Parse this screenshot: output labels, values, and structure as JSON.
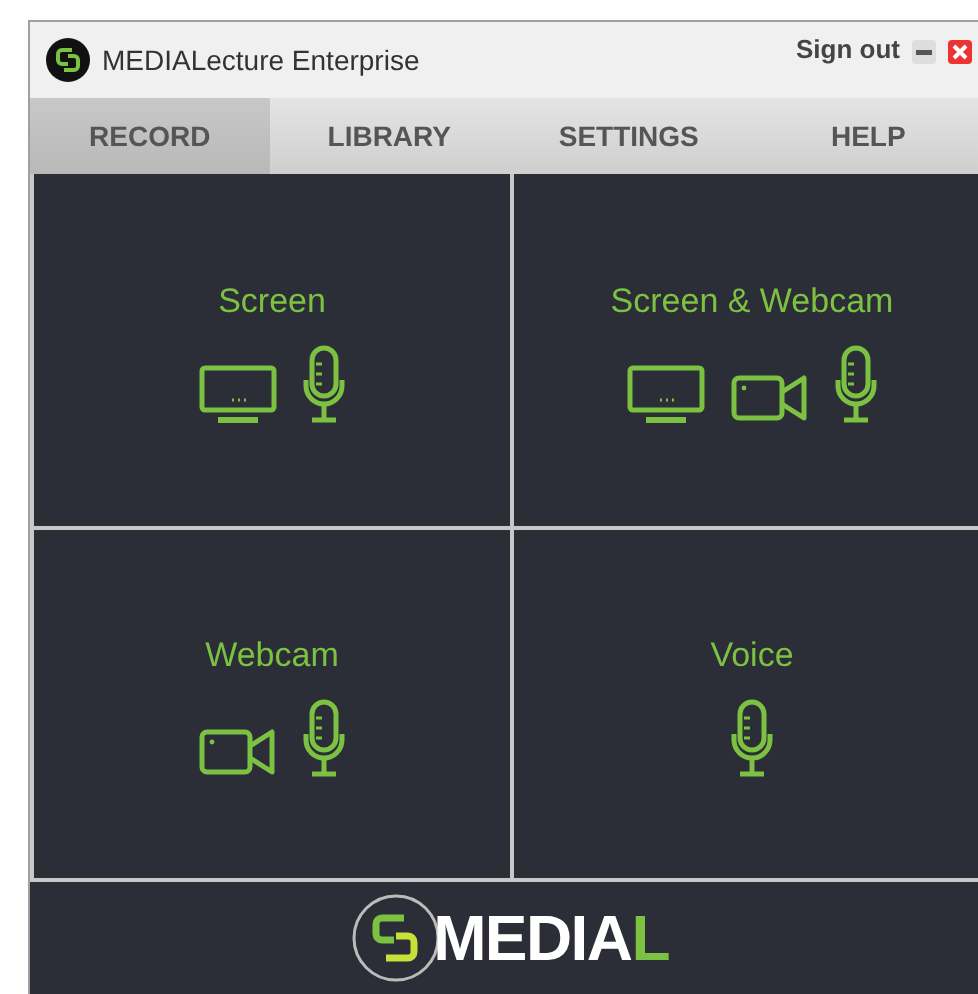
{
  "window": {
    "title": "MEDIALecture Enterprise",
    "sign_out": "Sign out"
  },
  "tabs": [
    {
      "label": "RECORD",
      "selected": true
    },
    {
      "label": "LIBRARY",
      "selected": false
    },
    {
      "label": "SETTINGS",
      "selected": false
    },
    {
      "label": "HELP",
      "selected": false
    }
  ],
  "tiles": [
    {
      "label": "Screen",
      "kind": "screen"
    },
    {
      "label": "Screen & Webcam",
      "kind": "screen_webcam"
    },
    {
      "label": "Webcam",
      "kind": "webcam"
    },
    {
      "label": "Voice",
      "kind": "voice"
    }
  ],
  "footer": {
    "logo_text": "MEDIA",
    "logo_accent": "L"
  }
}
